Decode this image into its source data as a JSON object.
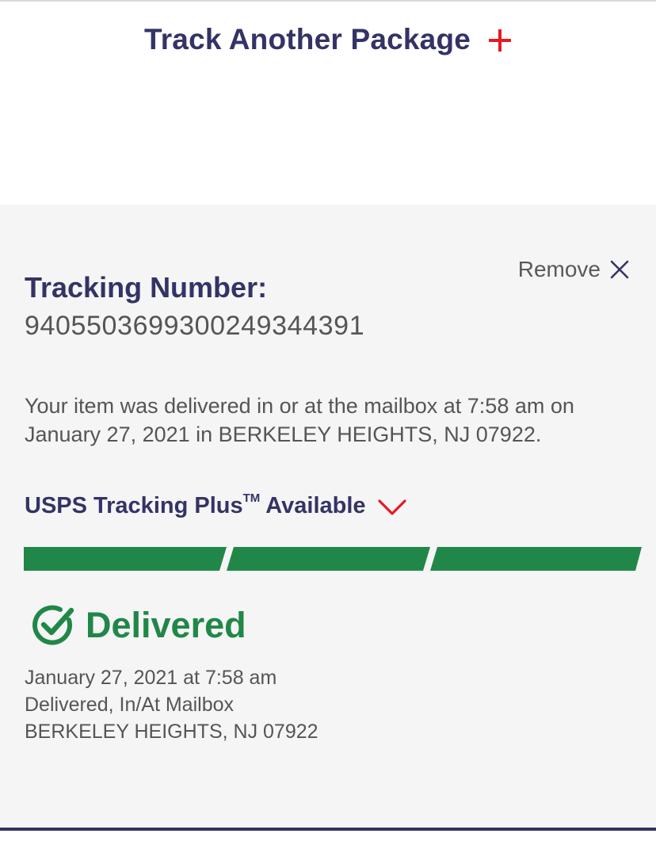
{
  "header": {
    "track_another_label": "Track Another Package",
    "add_icon": "plus-icon"
  },
  "colors": {
    "navy": "#333366",
    "red": "#e71921",
    "green": "#218748",
    "text_gray": "#555555",
    "card_bg": "#f5f5f5"
  },
  "card": {
    "remove_label": "Remove",
    "remove_icon": "close-icon",
    "tracking_heading": "Tracking Number:",
    "tracking_number": "9405503699300249344391",
    "status_summary": "Your item was delivered in or at the mailbox at 7:58 am on January 27, 2021 in BERKELEY HEIGHTS, NJ 07922.",
    "tracking_plus_label": "USPS Tracking Plus",
    "tracking_plus_tm": "TM",
    "tracking_plus_suffix": " Available",
    "tracking_plus_icon": "chevron-down-icon",
    "progress": {
      "segments_total": 3,
      "segments_complete": 3
    },
    "status_label": "Delivered",
    "status_icon": "check-circle-icon",
    "event": {
      "datetime": "January 27, 2021 at 7:58 am",
      "description": "Delivered, In/At Mailbox",
      "location": "BERKELEY HEIGHTS, NJ 07922"
    }
  }
}
